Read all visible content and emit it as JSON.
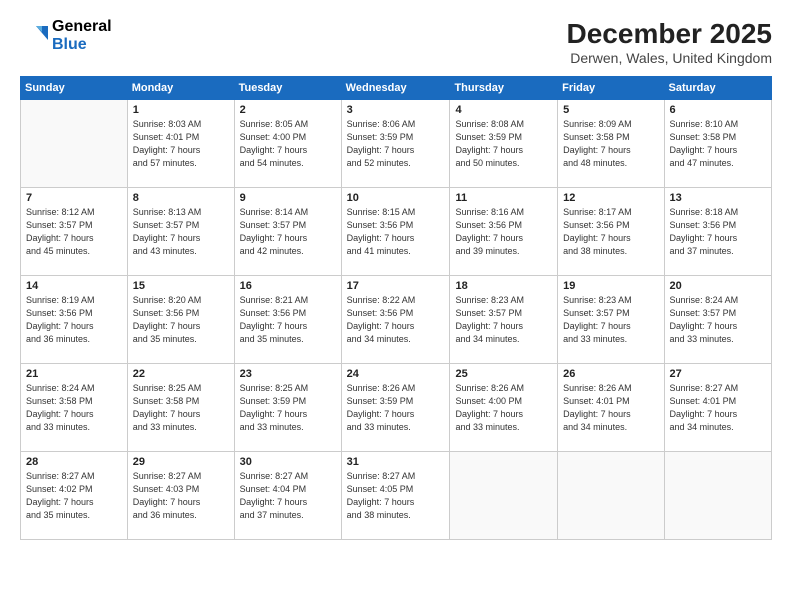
{
  "header": {
    "logo_general": "General",
    "logo_blue": "Blue",
    "title": "December 2025",
    "location": "Derwen, Wales, United Kingdom"
  },
  "days_of_week": [
    "Sunday",
    "Monday",
    "Tuesday",
    "Wednesday",
    "Thursday",
    "Friday",
    "Saturday"
  ],
  "weeks": [
    [
      {
        "day": "",
        "info": ""
      },
      {
        "day": "1",
        "info": "Sunrise: 8:03 AM\nSunset: 4:01 PM\nDaylight: 7 hours\nand 57 minutes."
      },
      {
        "day": "2",
        "info": "Sunrise: 8:05 AM\nSunset: 4:00 PM\nDaylight: 7 hours\nand 54 minutes."
      },
      {
        "day": "3",
        "info": "Sunrise: 8:06 AM\nSunset: 3:59 PM\nDaylight: 7 hours\nand 52 minutes."
      },
      {
        "day": "4",
        "info": "Sunrise: 8:08 AM\nSunset: 3:59 PM\nDaylight: 7 hours\nand 50 minutes."
      },
      {
        "day": "5",
        "info": "Sunrise: 8:09 AM\nSunset: 3:58 PM\nDaylight: 7 hours\nand 48 minutes."
      },
      {
        "day": "6",
        "info": "Sunrise: 8:10 AM\nSunset: 3:58 PM\nDaylight: 7 hours\nand 47 minutes."
      }
    ],
    [
      {
        "day": "7",
        "info": "Sunrise: 8:12 AM\nSunset: 3:57 PM\nDaylight: 7 hours\nand 45 minutes."
      },
      {
        "day": "8",
        "info": "Sunrise: 8:13 AM\nSunset: 3:57 PM\nDaylight: 7 hours\nand 43 minutes."
      },
      {
        "day": "9",
        "info": "Sunrise: 8:14 AM\nSunset: 3:57 PM\nDaylight: 7 hours\nand 42 minutes."
      },
      {
        "day": "10",
        "info": "Sunrise: 8:15 AM\nSunset: 3:56 PM\nDaylight: 7 hours\nand 41 minutes."
      },
      {
        "day": "11",
        "info": "Sunrise: 8:16 AM\nSunset: 3:56 PM\nDaylight: 7 hours\nand 39 minutes."
      },
      {
        "day": "12",
        "info": "Sunrise: 8:17 AM\nSunset: 3:56 PM\nDaylight: 7 hours\nand 38 minutes."
      },
      {
        "day": "13",
        "info": "Sunrise: 8:18 AM\nSunset: 3:56 PM\nDaylight: 7 hours\nand 37 minutes."
      }
    ],
    [
      {
        "day": "14",
        "info": "Sunrise: 8:19 AM\nSunset: 3:56 PM\nDaylight: 7 hours\nand 36 minutes."
      },
      {
        "day": "15",
        "info": "Sunrise: 8:20 AM\nSunset: 3:56 PM\nDaylight: 7 hours\nand 35 minutes."
      },
      {
        "day": "16",
        "info": "Sunrise: 8:21 AM\nSunset: 3:56 PM\nDaylight: 7 hours\nand 35 minutes."
      },
      {
        "day": "17",
        "info": "Sunrise: 8:22 AM\nSunset: 3:56 PM\nDaylight: 7 hours\nand 34 minutes."
      },
      {
        "day": "18",
        "info": "Sunrise: 8:23 AM\nSunset: 3:57 PM\nDaylight: 7 hours\nand 34 minutes."
      },
      {
        "day": "19",
        "info": "Sunrise: 8:23 AM\nSunset: 3:57 PM\nDaylight: 7 hours\nand 33 minutes."
      },
      {
        "day": "20",
        "info": "Sunrise: 8:24 AM\nSunset: 3:57 PM\nDaylight: 7 hours\nand 33 minutes."
      }
    ],
    [
      {
        "day": "21",
        "info": "Sunrise: 8:24 AM\nSunset: 3:58 PM\nDaylight: 7 hours\nand 33 minutes."
      },
      {
        "day": "22",
        "info": "Sunrise: 8:25 AM\nSunset: 3:58 PM\nDaylight: 7 hours\nand 33 minutes."
      },
      {
        "day": "23",
        "info": "Sunrise: 8:25 AM\nSunset: 3:59 PM\nDaylight: 7 hours\nand 33 minutes."
      },
      {
        "day": "24",
        "info": "Sunrise: 8:26 AM\nSunset: 3:59 PM\nDaylight: 7 hours\nand 33 minutes."
      },
      {
        "day": "25",
        "info": "Sunrise: 8:26 AM\nSunset: 4:00 PM\nDaylight: 7 hours\nand 33 minutes."
      },
      {
        "day": "26",
        "info": "Sunrise: 8:26 AM\nSunset: 4:01 PM\nDaylight: 7 hours\nand 34 minutes."
      },
      {
        "day": "27",
        "info": "Sunrise: 8:27 AM\nSunset: 4:01 PM\nDaylight: 7 hours\nand 34 minutes."
      }
    ],
    [
      {
        "day": "28",
        "info": "Sunrise: 8:27 AM\nSunset: 4:02 PM\nDaylight: 7 hours\nand 35 minutes."
      },
      {
        "day": "29",
        "info": "Sunrise: 8:27 AM\nSunset: 4:03 PM\nDaylight: 7 hours\nand 36 minutes."
      },
      {
        "day": "30",
        "info": "Sunrise: 8:27 AM\nSunset: 4:04 PM\nDaylight: 7 hours\nand 37 minutes."
      },
      {
        "day": "31",
        "info": "Sunrise: 8:27 AM\nSunset: 4:05 PM\nDaylight: 7 hours\nand 38 minutes."
      },
      {
        "day": "",
        "info": ""
      },
      {
        "day": "",
        "info": ""
      },
      {
        "day": "",
        "info": ""
      }
    ]
  ]
}
